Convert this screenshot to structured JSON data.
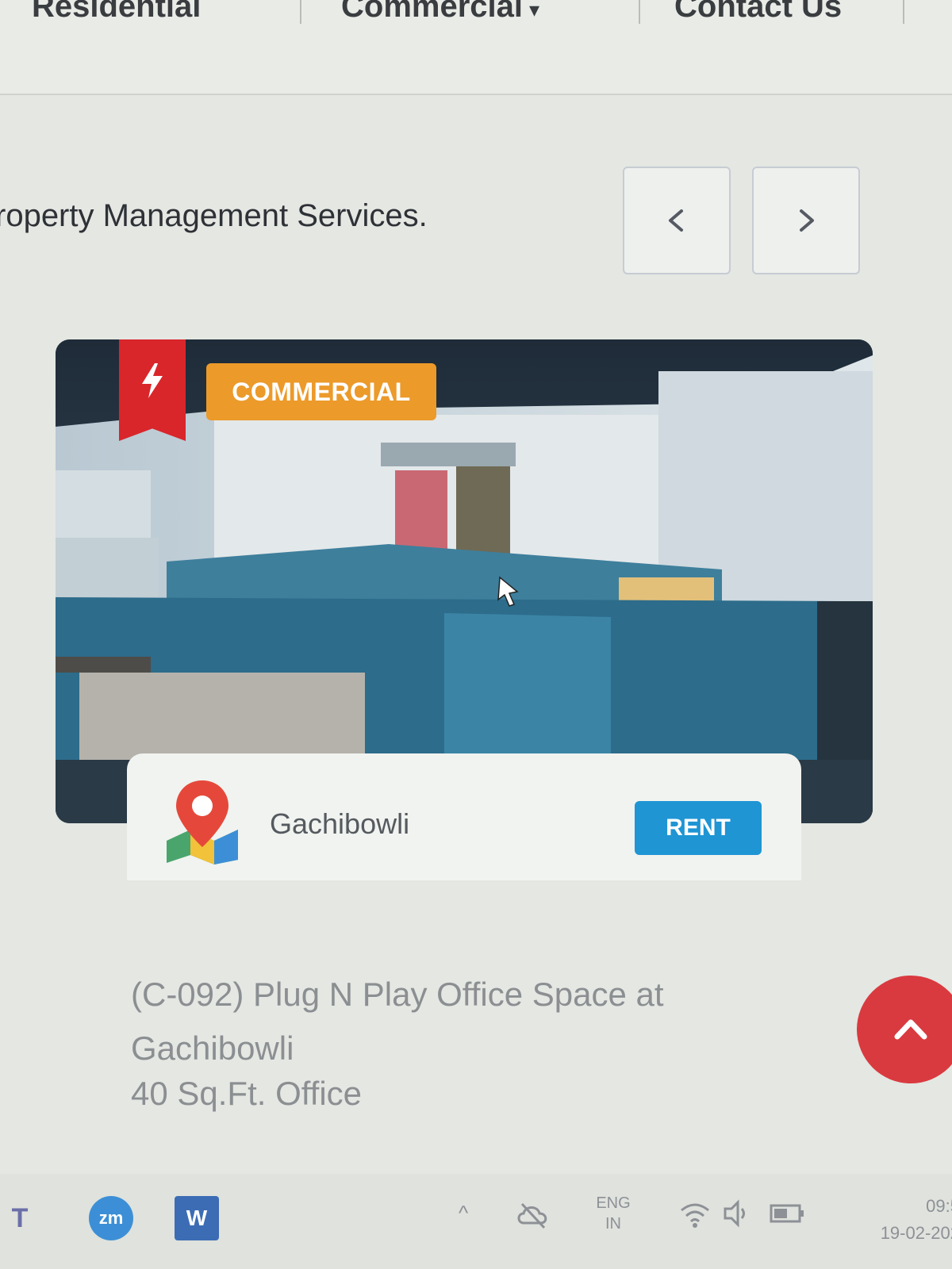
{
  "nav": {
    "items": [
      {
        "label": "Residential"
      },
      {
        "label": "Commercial",
        "caret": "▾"
      },
      {
        "label": "Contact Us"
      }
    ]
  },
  "intro": {
    "text": "roperty Management Services."
  },
  "carousel": {
    "prev_icon": "chevron-left-icon",
    "next_icon": "chevron-right-icon"
  },
  "listing": {
    "flash_icon": "lightning-icon",
    "badge": "COMMERCIAL",
    "location": "Gachibowli",
    "deal_type": "RENT",
    "title": "(C-092) Plug N Play Office Space at Gachibowli",
    "size": "40 Sq.Ft. Office"
  },
  "scroll_top": {
    "icon": "chevron-up-icon"
  },
  "taskbar": {
    "apps": [
      {
        "name": "teams",
        "label": "T"
      },
      {
        "name": "zoom",
        "label": "zm"
      },
      {
        "name": "word",
        "label": "W"
      }
    ],
    "lang_top": "ENG",
    "lang_bottom": "IN",
    "time": "09:5",
    "date": "19-02-202"
  },
  "colors": {
    "badge": "#ec9a2a",
    "ribbon": "#d9262b",
    "rent": "#1f95d4",
    "scroll_top": "#d93a3f"
  }
}
